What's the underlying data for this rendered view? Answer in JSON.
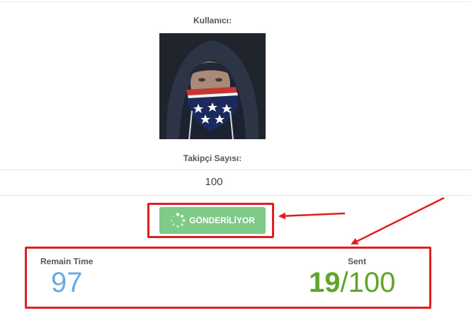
{
  "profile": {
    "user_label": "Kullanıcı:",
    "follower_label": "Takipçi Sayısı:",
    "follower_value": "100"
  },
  "action": {
    "button_label": "GÖNDERİLİYOR"
  },
  "stats": {
    "remain_label": "Remain Time",
    "remain_value": "97",
    "sent_label": "Sent",
    "sent_count": "19",
    "sent_separator": "/",
    "sent_total": "100"
  },
  "colors": {
    "button_bg": "#7fca86",
    "remain_value": "#6aa8e6",
    "sent_value": "#5fa52a",
    "annotation": "#e11d1d"
  },
  "icons": {
    "button_icon": "spinner-icon",
    "avatar": "avatar"
  }
}
